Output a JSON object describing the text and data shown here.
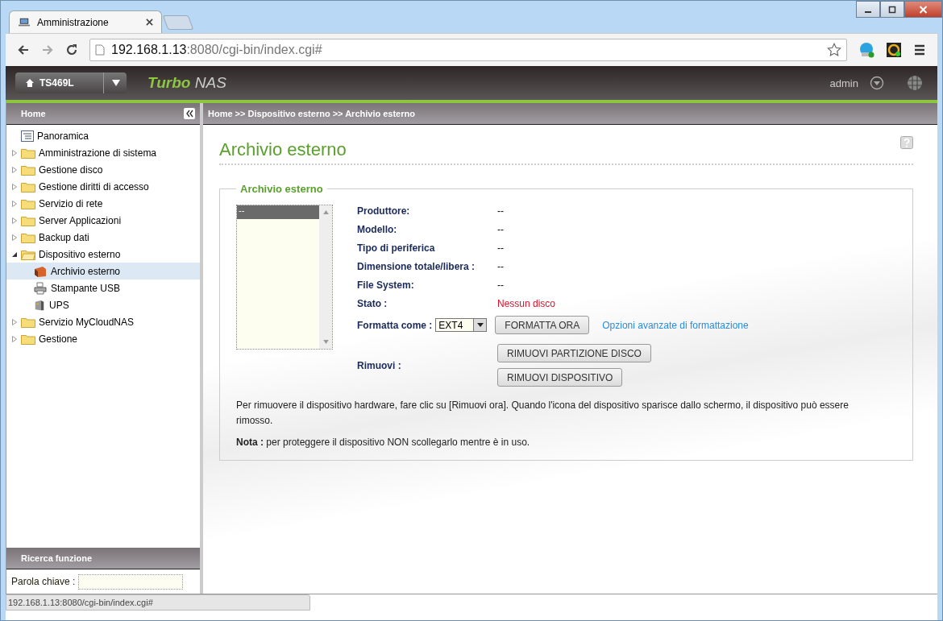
{
  "browser": {
    "tab_title": "Amministrazione",
    "url_host": "192.168.1.13",
    "url_rest": ":8080/cgi-bin/index.cgi#",
    "status_url": "192.168.1.13:8080/cgi-bin/index.cgi#"
  },
  "header": {
    "device": "TS469L",
    "brand_bold": "Turbo",
    "brand_rest": "NAS",
    "user": "admin"
  },
  "sidebar": {
    "title": "Home",
    "items": [
      {
        "label": "Panoramica",
        "kind": "overview",
        "selected": false
      },
      {
        "label": "Amministrazione di sistema",
        "kind": "folder",
        "expanded": false,
        "selected": false
      },
      {
        "label": "Gestione disco",
        "kind": "folder",
        "expanded": false,
        "selected": false
      },
      {
        "label": "Gestione diritti di accesso",
        "kind": "folder",
        "expanded": false,
        "selected": false
      },
      {
        "label": "Servizio di rete",
        "kind": "folder",
        "expanded": false,
        "selected": false
      },
      {
        "label": "Server Applicazioni",
        "kind": "folder",
        "expanded": false,
        "selected": false
      },
      {
        "label": "Backup dati",
        "kind": "folder",
        "expanded": false,
        "selected": false
      },
      {
        "label": "Dispositivo esterno",
        "kind": "folder",
        "expanded": true,
        "selected": false,
        "children": [
          {
            "label": "Archivio esterno",
            "kind": "storage",
            "selected": true
          },
          {
            "label": "Stampante USB",
            "kind": "printer",
            "selected": false
          },
          {
            "label": "UPS",
            "kind": "ups",
            "selected": false
          }
        ]
      },
      {
        "label": "Servizio MyCloudNAS",
        "kind": "folder",
        "expanded": false,
        "selected": false
      },
      {
        "label": "Gestione",
        "kind": "folder",
        "expanded": false,
        "selected": false
      }
    ]
  },
  "search": {
    "title": "Ricerca funzione",
    "label": "Parola chiave :"
  },
  "breadcrumb": "Home >> Dispositivo esterno >> Archivio esterno",
  "page": {
    "title": "Archivio esterno",
    "panel_title": "Archivio esterno",
    "devices": [
      {
        "label": "--",
        "selected": true
      }
    ],
    "fields": [
      {
        "label": "Produttore:",
        "value": "--",
        "kind": "info"
      },
      {
        "label": "Modello:",
        "value": "--",
        "kind": "info"
      },
      {
        "label": "Tipo di periferica",
        "value": "--",
        "kind": "info"
      },
      {
        "label": "Dimensione totale/libera :",
        "value": "--",
        "kind": "info"
      },
      {
        "label": "File System:",
        "value": "--",
        "kind": "info"
      },
      {
        "label": "Stato :",
        "value": "Nessun disco",
        "kind": "status"
      }
    ],
    "format": {
      "label": "Formatta come :",
      "value": "EXT4",
      "button": "FORMATTA ORA",
      "link": "Opzioni avanzate di formattazione"
    },
    "remove": {
      "label": "Rimuovi :",
      "buttons": [
        "RIMUOVI PARTIZIONE DISCO",
        "RIMUOVI DISPOSITIVO"
      ]
    },
    "instructions": "Per rimuovere il dispositivo hardware, fare clic su [Rimuovi ora]. Quando l'icona del dispositivo sparisce dallo schermo, il dispositivo può essere rimosso.",
    "note": "**Nota :** per proteggere il dispositivo NON scollegarlo mentre è in uso."
  }
}
